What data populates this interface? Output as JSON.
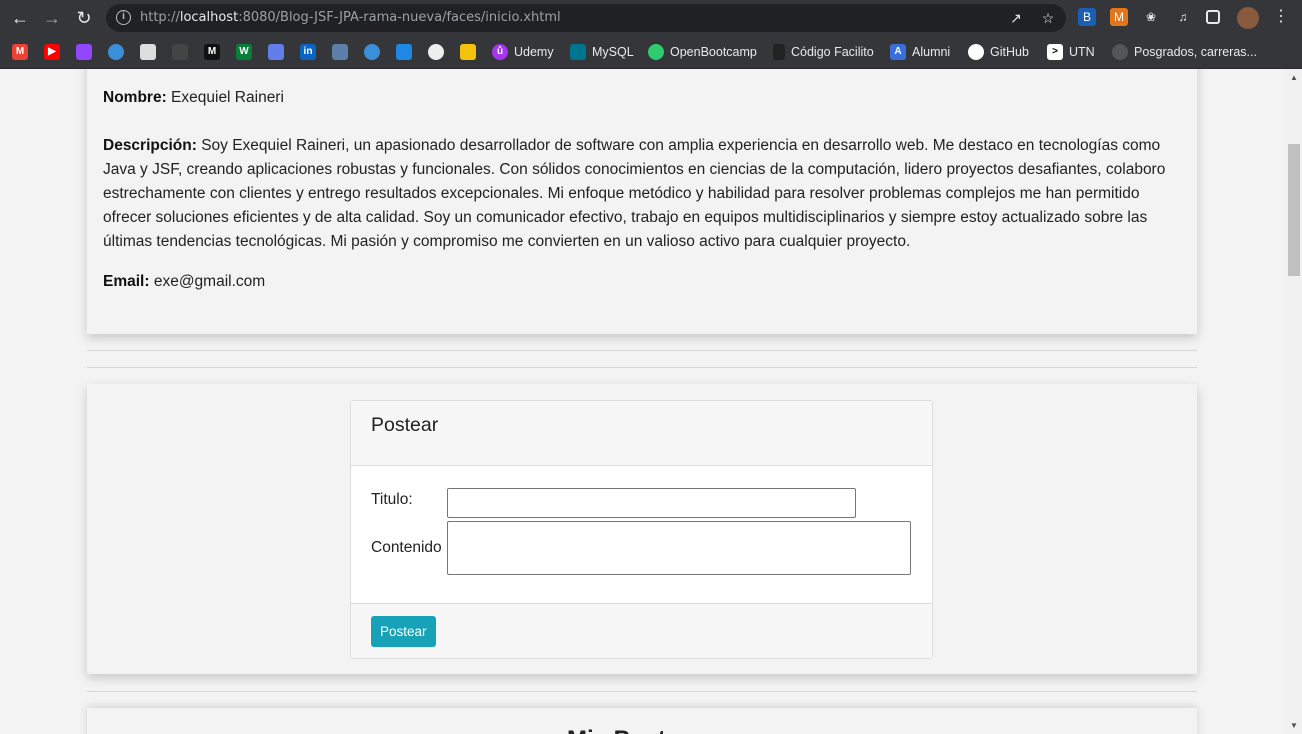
{
  "browser": {
    "url_prefix": "http://",
    "url_host": "localhost",
    "url_rest": ":8080/Blog-JSF-JPA-rama-nueva/faces/inicio.xhtml",
    "bookmarks": [
      "Udemy",
      "MySQL",
      "OpenBootcamp",
      "Código Facilito",
      "Alumni",
      "GitHub",
      "UTN",
      "Posgrados, carreras..."
    ]
  },
  "profile": {
    "name_label": "Nombre:",
    "name_value": "Exequiel Raineri",
    "desc_label": "Descripción:",
    "desc_value": "Soy Exequiel Raineri, un apasionado desarrollador de software con amplia experiencia en desarrollo web. Me destaco en tecnologías como Java y JSF, creando aplicaciones robustas y funcionales. Con sólidos conocimientos en ciencias de la computación, lidero proyectos desafiantes, colaboro estrechamente con clientes y entrego resultados excepcionales. Mi enfoque metódico y habilidad para resolver problemas complejos me han permitido ofrecer soluciones eficientes y de alta calidad. Soy un comunicador efectivo, trabajo en equipos multidisciplinarios y siempre estoy actualizado sobre las últimas tendencias tecnológicas. Mi pasión y compromiso me convierten en un valioso activo para cualquier proyecto.",
    "email_label": "Email:",
    "email_value": "exe@gmail.com"
  },
  "post_form": {
    "title": "Postear",
    "titulo_label": "Titulo:",
    "contenido_label": "Contenido",
    "titulo_value": "",
    "contenido_value": "",
    "submit_label": "Postear"
  },
  "next_section": {
    "title": "Mis Posts"
  },
  "colors": {
    "button": "#17a2b8",
    "chrome": "#35363a"
  }
}
